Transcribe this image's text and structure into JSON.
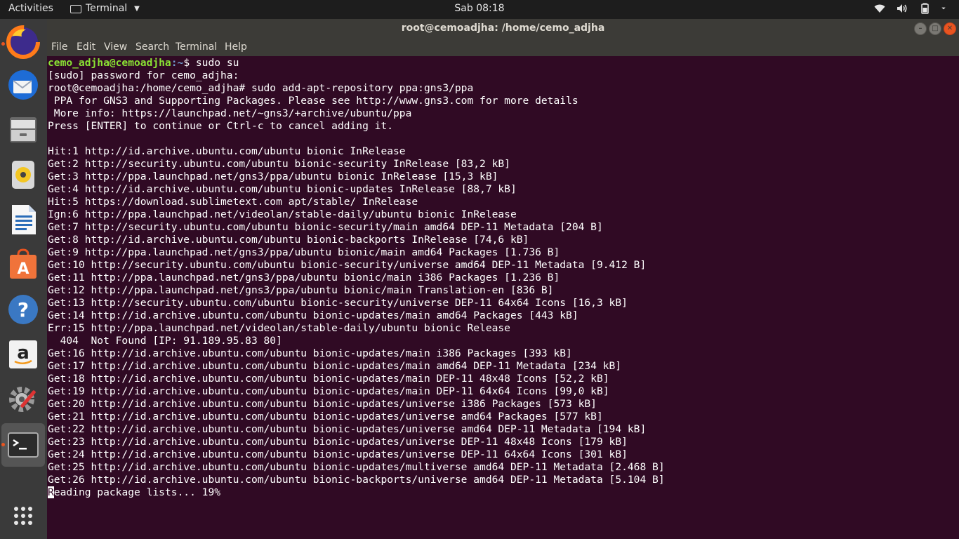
{
  "top_panel": {
    "activities": "Activities",
    "app_name": "Terminal",
    "clock": "Sab 08:18"
  },
  "dock": {
    "items": [
      "Firefox",
      "Thunderbird",
      "Files",
      "Rhythmbox",
      "LibreOffice Writer",
      "Ubuntu Software",
      "Help",
      "Amazon",
      "System Settings",
      "Terminal",
      "Show Applications"
    ]
  },
  "window": {
    "title": "root@cemoadjha: /home/cemo_adjha",
    "menu": [
      "File",
      "Edit",
      "View",
      "Search",
      "Terminal",
      "Help"
    ]
  },
  "terminal": {
    "prompt_user": "cemo_adjha@cemoadjha",
    "prompt_path": ":~",
    "first_command": "$ sudo su",
    "lines": [
      "[sudo] password for cemo_adjha:",
      "root@cemoadjha:/home/cemo_adjha# sudo add-apt-repository ppa:gns3/ppa",
      " PPA for GNS3 and Supporting Packages. Please see http://www.gns3.com for more details",
      " More info: https://launchpad.net/~gns3/+archive/ubuntu/ppa",
      "Press [ENTER] to continue or Ctrl-c to cancel adding it.",
      "",
      "Hit:1 http://id.archive.ubuntu.com/ubuntu bionic InRelease",
      "Get:2 http://security.ubuntu.com/ubuntu bionic-security InRelease [83,2 kB]",
      "Get:3 http://ppa.launchpad.net/gns3/ppa/ubuntu bionic InRelease [15,3 kB]",
      "Get:4 http://id.archive.ubuntu.com/ubuntu bionic-updates InRelease [88,7 kB]",
      "Hit:5 https://download.sublimetext.com apt/stable/ InRelease",
      "Ign:6 http://ppa.launchpad.net/videolan/stable-daily/ubuntu bionic InRelease",
      "Get:7 http://security.ubuntu.com/ubuntu bionic-security/main amd64 DEP-11 Metadata [204 B]",
      "Get:8 http://id.archive.ubuntu.com/ubuntu bionic-backports InRelease [74,6 kB]",
      "Get:9 http://ppa.launchpad.net/gns3/ppa/ubuntu bionic/main amd64 Packages [1.736 B]",
      "Get:10 http://security.ubuntu.com/ubuntu bionic-security/universe amd64 DEP-11 Metadata [9.412 B]",
      "Get:11 http://ppa.launchpad.net/gns3/ppa/ubuntu bionic/main i386 Packages [1.236 B]",
      "Get:12 http://ppa.launchpad.net/gns3/ppa/ubuntu bionic/main Translation-en [836 B]",
      "Get:13 http://security.ubuntu.com/ubuntu bionic-security/universe DEP-11 64x64 Icons [16,3 kB]",
      "Get:14 http://id.archive.ubuntu.com/ubuntu bionic-updates/main amd64 Packages [443 kB]",
      "Err:15 http://ppa.launchpad.net/videolan/stable-daily/ubuntu bionic Release",
      "  404  Not Found [IP: 91.189.95.83 80]",
      "Get:16 http://id.archive.ubuntu.com/ubuntu bionic-updates/main i386 Packages [393 kB]",
      "Get:17 http://id.archive.ubuntu.com/ubuntu bionic-updates/main amd64 DEP-11 Metadata [234 kB]",
      "Get:18 http://id.archive.ubuntu.com/ubuntu bionic-updates/main DEP-11 48x48 Icons [52,2 kB]",
      "Get:19 http://id.archive.ubuntu.com/ubuntu bionic-updates/main DEP-11 64x64 Icons [99,0 kB]",
      "Get:20 http://id.archive.ubuntu.com/ubuntu bionic-updates/universe i386 Packages [573 kB]",
      "Get:21 http://id.archive.ubuntu.com/ubuntu bionic-updates/universe amd64 Packages [577 kB]",
      "Get:22 http://id.archive.ubuntu.com/ubuntu bionic-updates/universe amd64 DEP-11 Metadata [194 kB]",
      "Get:23 http://id.archive.ubuntu.com/ubuntu bionic-updates/universe DEP-11 48x48 Icons [179 kB]",
      "Get:24 http://id.archive.ubuntu.com/ubuntu bionic-updates/universe DEP-11 64x64 Icons [301 kB]",
      "Get:25 http://id.archive.ubuntu.com/ubuntu bionic-updates/multiverse amd64 DEP-11 Metadata [2.468 B]",
      "Get:26 http://id.archive.ubuntu.com/ubuntu bionic-backports/universe amd64 DEP-11 Metadata [5.104 B]"
    ],
    "last_line_cursor_char": "R",
    "last_line_rest": "eading package lists... 19%"
  },
  "colors": {
    "terminal_bg": "#300a24",
    "prompt_user": "#8ae234",
    "prompt_path": "#729fcf",
    "accent": "#e95420"
  }
}
